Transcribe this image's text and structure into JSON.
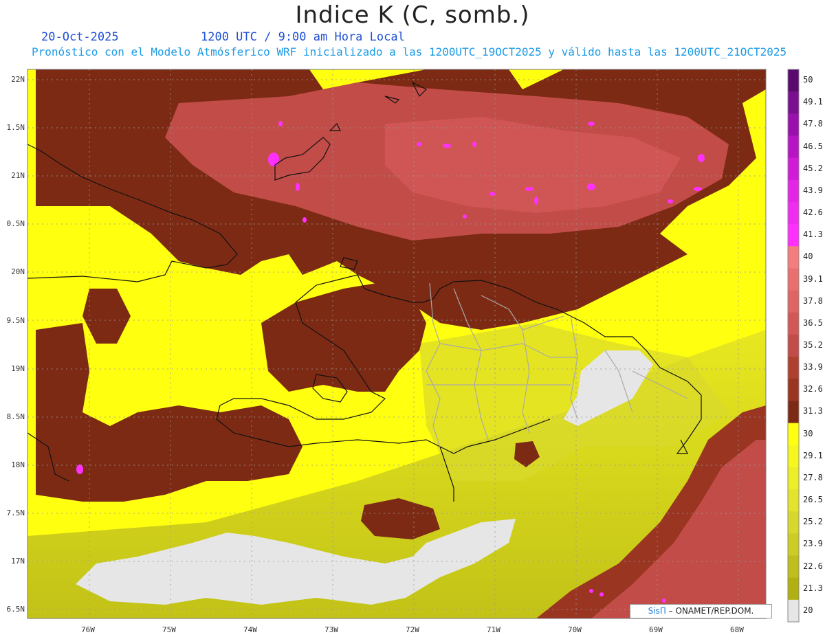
{
  "header": {
    "title": "Indice K (C, somb.)",
    "date": "20-Oct-2025",
    "utc": "1200 UTC / 9:00 am Hora Local",
    "description": "Pronóstico con el Modelo Atmósferico WRF inicializado a las 1200UTC_19OCT2025 y válido hasta las  1200UTC_21OCT2025"
  },
  "lat_labels": [
    "22N",
    "1.5N",
    "21N",
    "0.5N",
    "20N",
    "9.5N",
    "19N",
    "8.5N",
    "18N",
    "7.5N",
    "17N",
    "6.5N"
  ],
  "lon_labels": [
    "76W",
    "75W",
    "74W",
    "73W",
    "72W",
    "71W",
    "70W",
    "69W",
    "68W"
  ],
  "colorbar": {
    "levels": [
      "50",
      "49.1",
      "47.8",
      "46.5",
      "45.2",
      "43.9",
      "42.6",
      "41.3",
      "40",
      "39.1",
      "37.8",
      "36.5",
      "35.2",
      "33.9",
      "32.6",
      "31.3",
      "30",
      "29.1",
      "27.8",
      "26.5",
      "25.2",
      "23.9",
      "22.6",
      "21.3",
      "20"
    ],
    "colors": [
      "#5a0a6e",
      "#7a0f8f",
      "#9a10ad",
      "#b814c6",
      "#d01cd8",
      "#e424e6",
      "#f02cf0",
      "#ff30ff",
      "#f47d7d",
      "#ea7070",
      "#e06464",
      "#d25858",
      "#c24c48",
      "#b0402e",
      "#9a3522",
      "#7c2a14",
      "#ffff10",
      "#f7f720",
      "#eeee28",
      "#e4e42c",
      "#d8d82c",
      "#cccc24",
      "#bebe1c",
      "#b0b010",
      "#e6e6e6"
    ]
  },
  "credit": {
    "brand": "SisΠ",
    "text": " – ONAMET/REP.DOM."
  },
  "fill_colors": {
    "yellow": "#ffff10",
    "brown": "#7c2a14",
    "salmon": "#c24c48",
    "magenta": "#ff30ff",
    "gray": "#e6e6e6",
    "olive": "#cccc24"
  }
}
